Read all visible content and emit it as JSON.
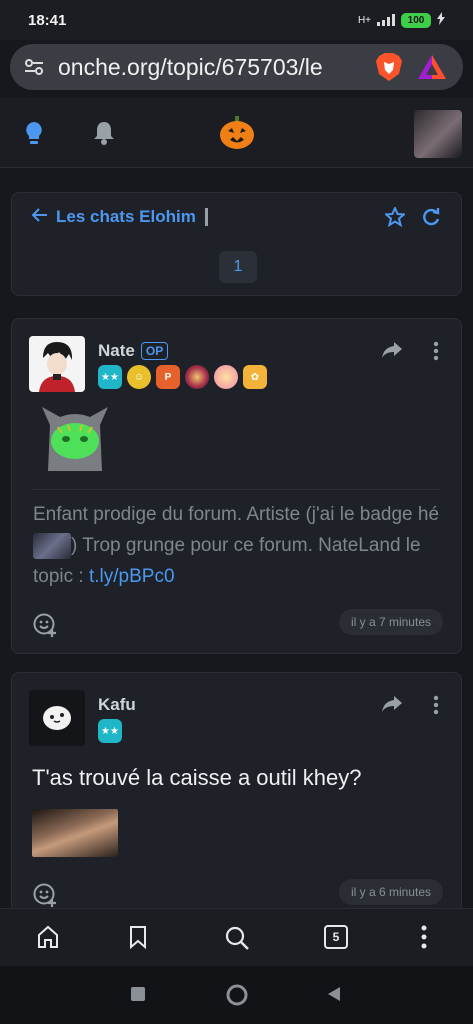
{
  "status_bar": {
    "time": "18:41",
    "network": "H+",
    "battery": "100"
  },
  "browser": {
    "url": "onche.org/topic/675703/le"
  },
  "topic": {
    "back_label": "Les chats Elohim",
    "current_page": "1"
  },
  "posts": [
    {
      "author": "Nate",
      "op_label": "OP",
      "badges": [
        "level-badge",
        "gold-face-badge",
        "p-badge",
        "mandala-badge",
        "anime-badge",
        "palette-badge"
      ],
      "signature_before": "Enfant prodige du forum. Artiste (j'ai le badge hé ",
      "signature_after": ") Trop grunge pour ce forum. NateLand le topic : ",
      "signature_link": "t.ly/pBPc0",
      "time": "il y a 7 minutes"
    },
    {
      "author": "Kafu",
      "badges": [
        "level-badge"
      ],
      "message": "T'as trouvé la caisse a outil khey?",
      "time": "il y a 6 minutes"
    }
  ],
  "bottom_nav": {
    "tab_count": "5"
  },
  "colors": {
    "accent": "#4c98f0",
    "background": "#16181d",
    "card": "#1f2128"
  }
}
